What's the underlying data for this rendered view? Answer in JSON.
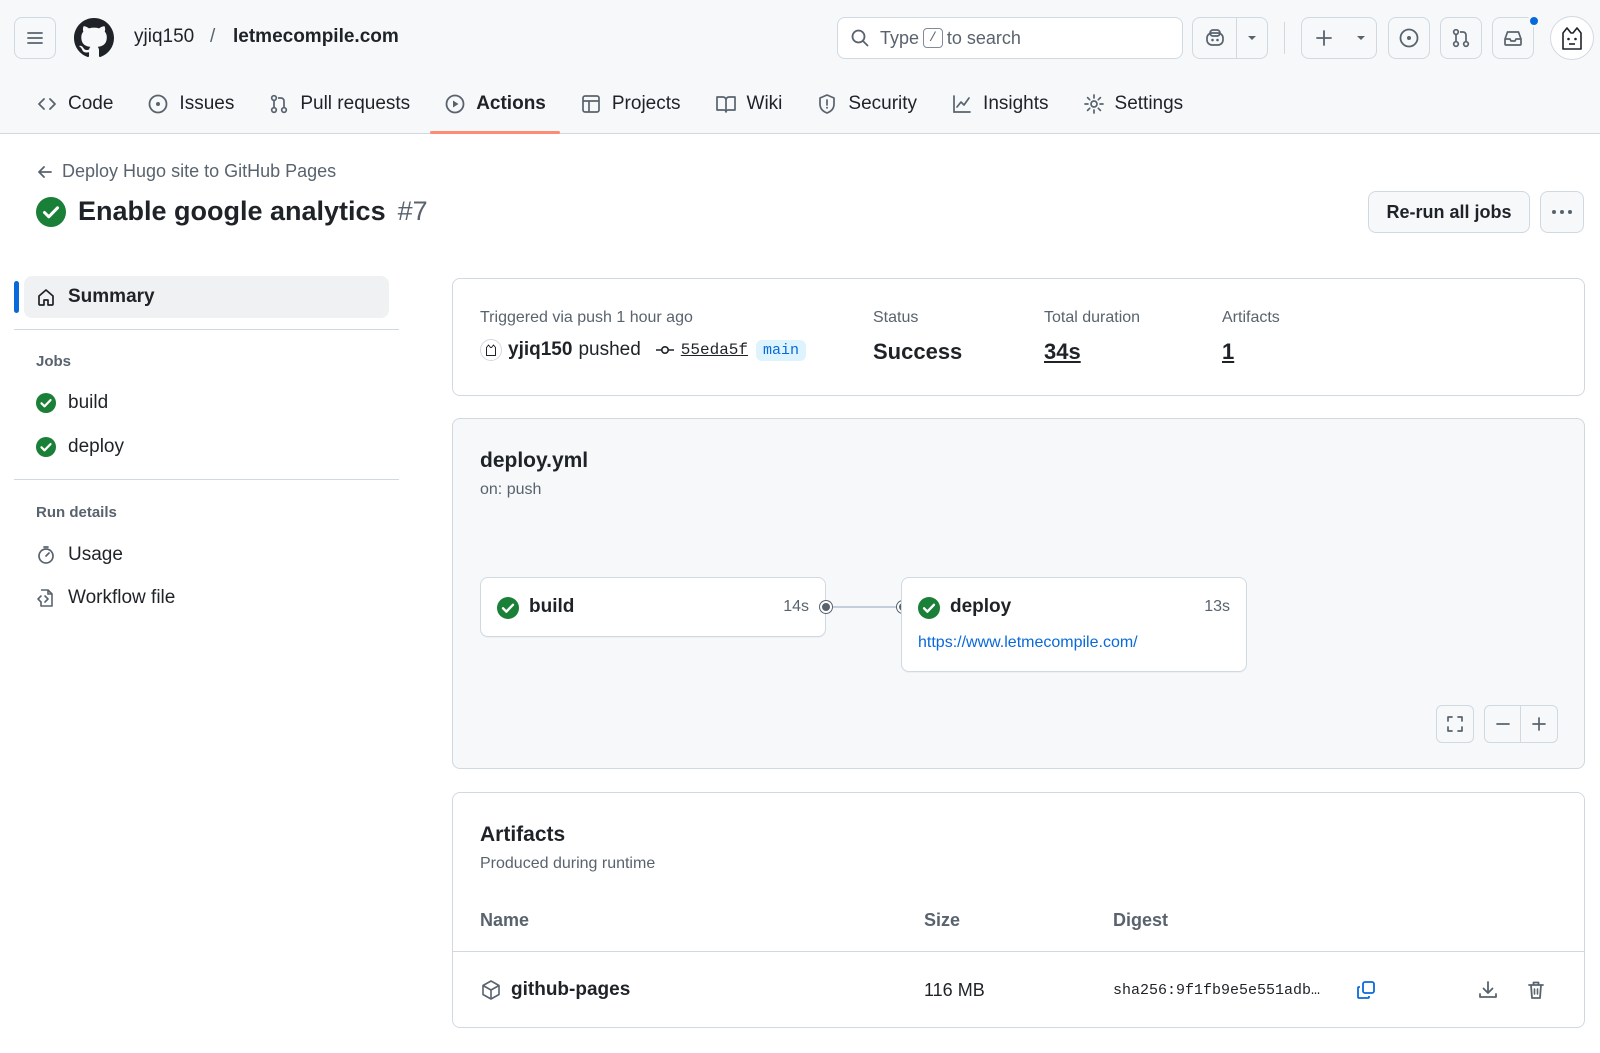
{
  "header": {
    "owner": "yjiq150",
    "separator": "/",
    "repo": "letmecompile.com",
    "search": {
      "prefix": "Type",
      "key": "/",
      "suffix": "to search"
    },
    "notification_dot_color": "#0969da"
  },
  "tabs": [
    {
      "label": "Code",
      "icon": "code-icon"
    },
    {
      "label": "Issues",
      "icon": "issue-icon"
    },
    {
      "label": "Pull requests",
      "icon": "pull-request-icon"
    },
    {
      "label": "Actions",
      "icon": "play-icon",
      "active": true
    },
    {
      "label": "Projects",
      "icon": "table-icon"
    },
    {
      "label": "Wiki",
      "icon": "book-icon"
    },
    {
      "label": "Security",
      "icon": "shield-icon"
    },
    {
      "label": "Insights",
      "icon": "graph-icon"
    },
    {
      "label": "Settings",
      "icon": "gear-icon"
    }
  ],
  "page": {
    "back_label": "Deploy Hugo site to GitHub Pages",
    "title": "Enable google analytics",
    "run_number": "#7",
    "rerun_label": "Re-run all jobs",
    "more_label": "···"
  },
  "sidebar": {
    "summary_label": "Summary",
    "jobs_heading": "Jobs",
    "jobs": [
      {
        "label": "build",
        "status": "success"
      },
      {
        "label": "deploy",
        "status": "success"
      }
    ],
    "run_details_heading": "Run details",
    "run_details": [
      {
        "label": "Usage",
        "icon": "stopwatch-icon"
      },
      {
        "label": "Workflow file",
        "icon": "file-code-icon"
      }
    ]
  },
  "summary": {
    "trigger_label": "Triggered via push 1 hour ago",
    "actor": "yjiq150",
    "action": "pushed",
    "commit": "55eda5f",
    "branch": "main",
    "status_label": "Status",
    "status_value": "Success",
    "duration_label": "Total duration",
    "duration_value": "34s",
    "artifacts_label": "Artifacts",
    "artifacts_value": "1"
  },
  "workflow": {
    "file": "deploy.yml",
    "trigger": "on: push",
    "jobs": [
      {
        "name": "build",
        "duration": "14s"
      },
      {
        "name": "deploy",
        "duration": "13s",
        "url": "https://www.letmecompile.com/"
      }
    ]
  },
  "artifacts": {
    "title": "Artifacts",
    "subtitle": "Produced during runtime",
    "columns": [
      "Name",
      "Size",
      "Digest"
    ],
    "rows": [
      {
        "name": "github-pages",
        "size": "116 MB",
        "digest": "sha256:9f1fb9e5e551adb…"
      }
    ]
  },
  "colors": {
    "success": "#1a7f37",
    "accent": "#0969da",
    "active_tab_underline": "#fd8c73"
  }
}
